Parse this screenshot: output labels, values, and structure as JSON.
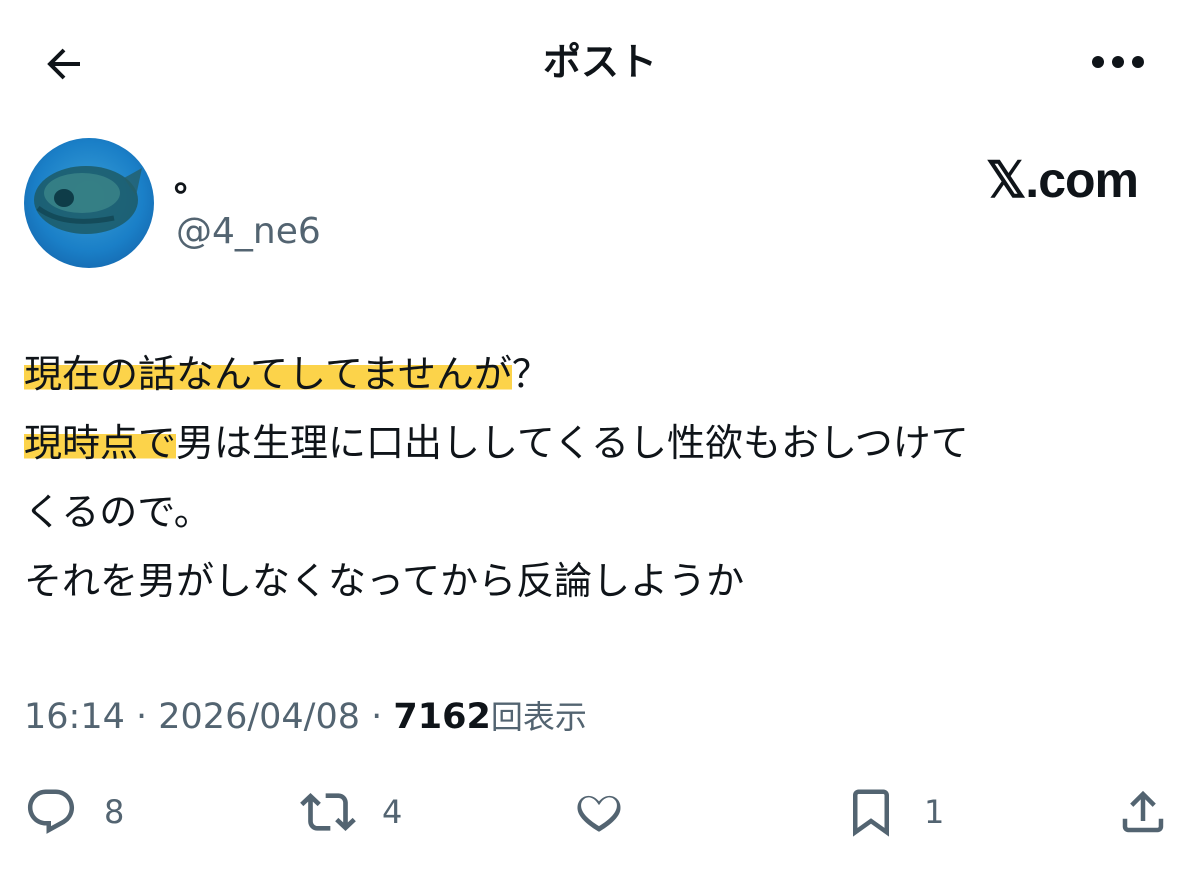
{
  "header": {
    "title": "ポスト"
  },
  "author": {
    "display_name": "。",
    "handle": "@4_ne6"
  },
  "brand": "𝕏.com",
  "tweet": {
    "line1_highlight": "現在の話なんてしてませんが",
    "line1_rest": "？",
    "line2_highlight": "現時点で",
    "line2_rest": "男は生理に口出ししてくるし性欲もおしつけて",
    "line3": "くるので。",
    "line4": "それを男がしなくなってから反論しようか"
  },
  "meta": {
    "time": "16:14",
    "sep1": " · ",
    "date": "2026/04/08",
    "sep2": " · ",
    "views_count": "7162",
    "views_label": "回表示"
  },
  "actions": {
    "reply_count": "8",
    "repost_count": "4",
    "like_count": "",
    "bookmark_count": "1"
  },
  "colors": {
    "text": "#0f1419",
    "secondary": "#536471",
    "highlight": "#fcd34a"
  }
}
